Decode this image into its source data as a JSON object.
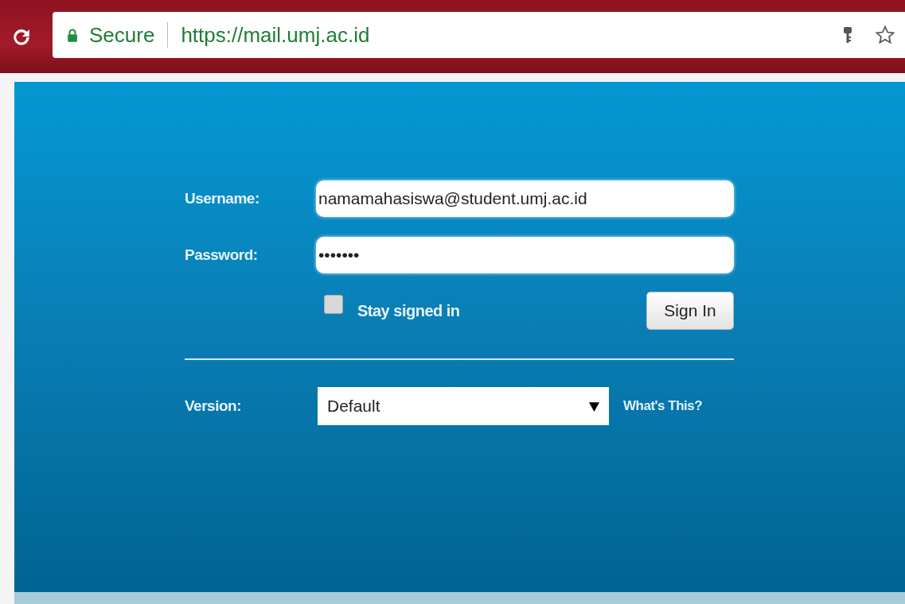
{
  "browser": {
    "security_label": "Secure",
    "url": "https://mail.umj.ac.id"
  },
  "login": {
    "username": {
      "label": "Username:",
      "value": "namamahasiswa@student.umj.ac.id"
    },
    "password": {
      "label": "Password:",
      "value": "•••••••"
    },
    "stay_signed_in": {
      "label": "Stay signed in",
      "checked": false
    },
    "sign_in_button": "Sign In",
    "version": {
      "label": "Version:",
      "value": "Default",
      "link": "What's This?"
    }
  }
}
